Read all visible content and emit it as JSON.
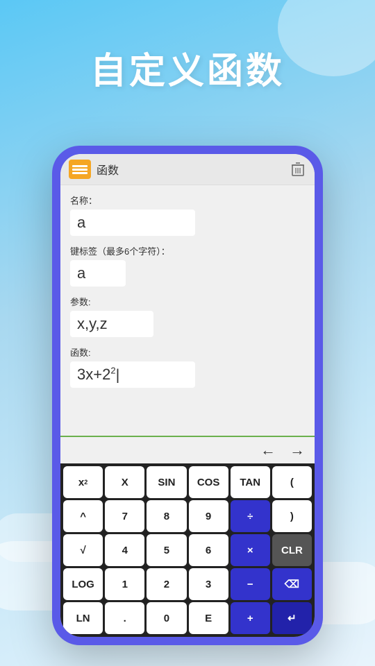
{
  "page": {
    "title": "自定义函数",
    "background_color": "#5bc8f5"
  },
  "top_bar": {
    "app_title": "函数",
    "trash_label": "🗑"
  },
  "form": {
    "name_label": "名称：",
    "name_value": "a",
    "keylabel_label": "键标签（最多6个字符）：",
    "keylabel_value": "a",
    "params_label": "参数:",
    "params_value": "x,y,z",
    "func_label": "函数:",
    "func_value": "3x+2"
  },
  "nav": {
    "left_arrow": "←",
    "right_arrow": "→"
  },
  "keyboard": {
    "rows": [
      [
        {
          "label": "x²",
          "type": "white",
          "sup": true
        },
        {
          "label": "X",
          "type": "white"
        },
        {
          "label": "SIN",
          "type": "white"
        },
        {
          "label": "COS",
          "type": "white"
        },
        {
          "label": "TAN",
          "type": "white"
        },
        {
          "label": "(",
          "type": "white"
        }
      ],
      [
        {
          "label": "^",
          "type": "white"
        },
        {
          "label": "7",
          "type": "white"
        },
        {
          "label": "8",
          "type": "white"
        },
        {
          "label": "9",
          "type": "white"
        },
        {
          "label": "÷",
          "type": "blue"
        },
        {
          "label": ")",
          "type": "white"
        }
      ],
      [
        {
          "label": "√",
          "type": "white"
        },
        {
          "label": "4",
          "type": "white"
        },
        {
          "label": "5",
          "type": "white"
        },
        {
          "label": "6",
          "type": "white"
        },
        {
          "label": "×",
          "type": "blue"
        },
        {
          "label": "CLR",
          "type": "gray"
        }
      ],
      [
        {
          "label": "LOG",
          "type": "white"
        },
        {
          "label": "1",
          "type": "white"
        },
        {
          "label": "2",
          "type": "white"
        },
        {
          "label": "3",
          "type": "white"
        },
        {
          "label": "−",
          "type": "blue"
        },
        {
          "label": "⌫",
          "type": "blue"
        }
      ],
      [
        {
          "label": "LN",
          "type": "white"
        },
        {
          "label": ".",
          "type": "white"
        },
        {
          "label": "0",
          "type": "white"
        },
        {
          "label": "E",
          "type": "white"
        },
        {
          "label": "+",
          "type": "blue"
        },
        {
          "label": "↵",
          "type": "dark-blue"
        }
      ]
    ]
  }
}
